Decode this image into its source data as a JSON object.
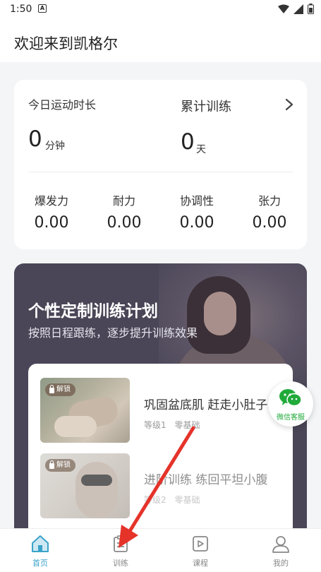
{
  "status": {
    "time": "1:50",
    "notification_icon": "A",
    "icons": [
      "wifi-icon",
      "signal-icon",
      "battery-icon"
    ]
  },
  "header": {
    "title": "欢迎来到凯格尔"
  },
  "stats": {
    "today_label": "今日运动时长",
    "today_value": "0",
    "today_unit": "分钟",
    "total_label": "累计训练",
    "total_value": "0",
    "total_unit": "天",
    "abilities": [
      {
        "label": "爆发力",
        "value": "0.00"
      },
      {
        "label": "耐力",
        "value": "0.00"
      },
      {
        "label": "协调性",
        "value": "0.00"
      },
      {
        "label": "张力",
        "value": "0.00"
      }
    ]
  },
  "plan": {
    "title": "个性定制训练计划",
    "subtitle": "按照日程跟练，逐步提升训练效果",
    "courses": [
      {
        "badge": "解锁",
        "title": "巩固盆底肌 赶走小肚子",
        "level": "等级1",
        "base": "零基础"
      },
      {
        "badge": "解锁",
        "title": "进阶训练 练回平坦小腹",
        "level": "等级2",
        "base": "零基础"
      }
    ]
  },
  "wechat": {
    "label": "微信客服"
  },
  "tabs": [
    {
      "label": "首页",
      "icon": "home-icon",
      "active": true
    },
    {
      "label": "训练",
      "icon": "training-icon",
      "active": false
    },
    {
      "label": "课程",
      "icon": "course-icon",
      "active": false
    },
    {
      "label": "我的",
      "icon": "profile-icon",
      "active": false
    }
  ],
  "colors": {
    "accent": "#3aa3c9",
    "plan_bg": "#4a4657",
    "wechat_green": "#1faa3a",
    "arrow_red": "#e5332a"
  }
}
